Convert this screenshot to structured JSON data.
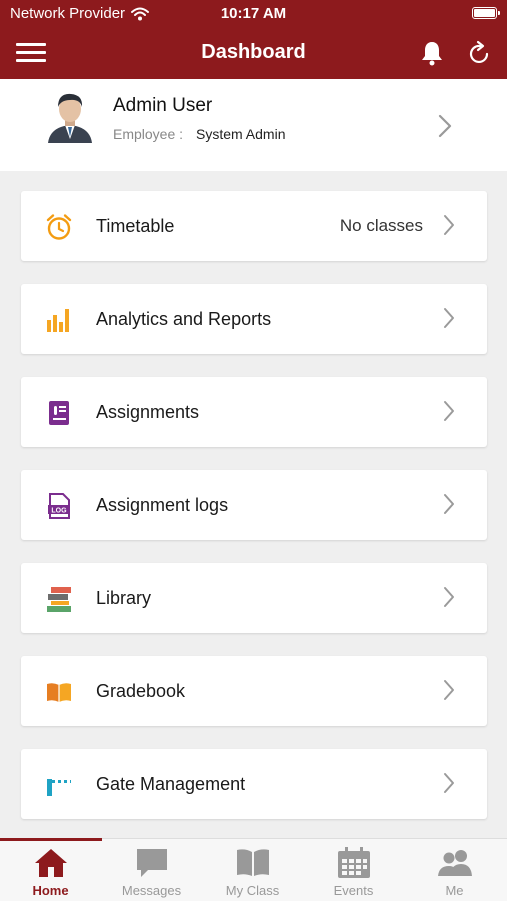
{
  "status": {
    "carrier": "Network Provider",
    "time": "10:17 AM"
  },
  "header": {
    "title": "Dashboard",
    "background_color": "#8d1a1d"
  },
  "profile": {
    "name": "Admin User",
    "role_label": "Employee :",
    "role_value": "System Admin"
  },
  "menu": [
    {
      "label": "Timetable",
      "detail": "No classes",
      "icon": "alarm-clock-icon",
      "icon_color": "#f39c12"
    },
    {
      "label": "Analytics and Reports",
      "icon": "bar-chart-icon",
      "icon_color": "#f5a623"
    },
    {
      "label": "Assignments",
      "icon": "assignment-icon",
      "icon_color": "#7b2d8e"
    },
    {
      "label": "Assignment logs",
      "icon": "log-file-icon",
      "icon_color": "#7b2d8e"
    },
    {
      "label": "Library",
      "icon": "books-icon",
      "icon_color": "#5aa469"
    },
    {
      "label": "Gradebook",
      "icon": "open-book-icon",
      "icon_color": "#e67e22"
    },
    {
      "label": "Gate Management",
      "icon": "gate-barrier-icon",
      "icon_color": "#1fa3c4"
    }
  ],
  "tabs": [
    {
      "label": "Home",
      "icon": "home-icon",
      "active": true
    },
    {
      "label": "Messages",
      "icon": "chat-bubble-icon",
      "active": false
    },
    {
      "label": "My Class",
      "icon": "book-icon",
      "active": false
    },
    {
      "label": "Events",
      "icon": "calendar-icon",
      "active": false
    },
    {
      "label": "Me",
      "icon": "people-icon",
      "active": false
    }
  ]
}
